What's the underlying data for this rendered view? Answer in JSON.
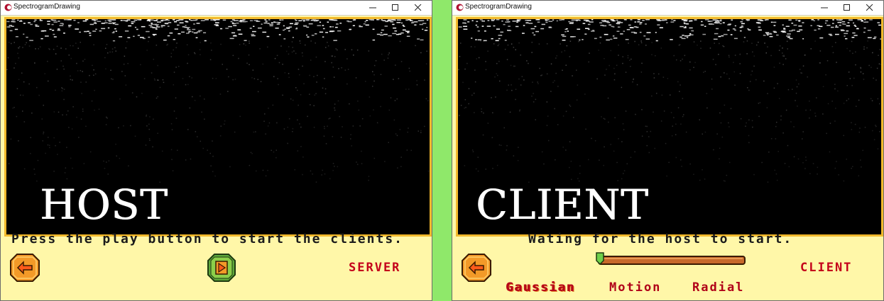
{
  "host_window": {
    "title": "SpectrogramDrawing",
    "big_label": "HOST",
    "status_text": "Press the play button to start the clients.",
    "role_label": "SERVER"
  },
  "client_window": {
    "title": "SpectrogramDrawing",
    "big_label": "CLIENT",
    "status_text": "Wating for the host to start.",
    "role_label": "CLIENT",
    "slider_value": 0.0,
    "filters": [
      {
        "label": "Gaussian",
        "selected": true
      },
      {
        "label": "Motion",
        "selected": false
      },
      {
        "label": "Radial",
        "selected": false
      }
    ]
  },
  "icons": {
    "back": "arrow-left-icon",
    "play": "play-icon",
    "minimize": "minimize-icon",
    "maximize": "maximize-icon",
    "close": "close-icon"
  },
  "colors": {
    "background": "#8fe86a",
    "panel": "#fff7a8",
    "screen_border": "#f2b92c",
    "role_label": "#c4001a",
    "back_button": "#f39a28",
    "play_button": "#5fa83c"
  }
}
